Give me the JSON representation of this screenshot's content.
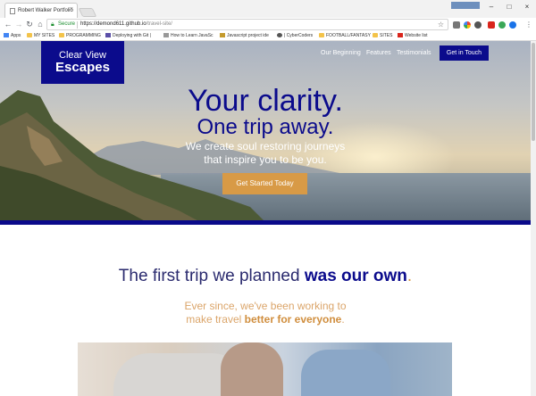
{
  "browser": {
    "tab_title": "Robert Walker Portfolio",
    "user_badge": "",
    "secure_label": "Secure",
    "url_host": "https://demond611.github.io",
    "url_path": "/travel-site/",
    "bookmarks": [
      {
        "label": "Apps",
        "icon": "apps-grid-icon"
      },
      {
        "label": "MY SITES",
        "icon": "folder-icon"
      },
      {
        "label": "PROGRAMMING",
        "icon": "folder-icon"
      },
      {
        "label": "Deploying with Git |",
        "icon": "page-icon"
      },
      {
        "label": "How to Learn JavaSc",
        "icon": "page-icon"
      },
      {
        "label": "Javascript project ide",
        "icon": "page-icon"
      },
      {
        "label": "| CyberCoders",
        "icon": "page-icon"
      },
      {
        "label": "FOOTBALL/FANTASY",
        "icon": "folder-icon"
      },
      {
        "label": "SITES",
        "icon": "folder-icon"
      },
      {
        "label": "Website list",
        "icon": "page-icon"
      }
    ]
  },
  "site": {
    "logo_line1": "Clear View",
    "logo_line2": "Escapes",
    "nav": [
      "Our Beginning",
      "Features",
      "Testimonials"
    ],
    "nav_cta": "Get in Touch",
    "headline_1": "Your clarity.",
    "headline_2": "One trip away.",
    "hero_sub_1": "We create soul restoring journeys",
    "hero_sub_2": "that inspire you to be you.",
    "hero_cta": "Get Started Today",
    "section_title_a": "The first trip we planned ",
    "section_title_b": "was our own",
    "section_title_c": ".",
    "section_sub_1": "Ever since, we've been working to",
    "section_sub_2a": "make travel ",
    "section_sub_2b": "better for everyone",
    "section_sub_2c": "."
  },
  "colors": {
    "brand_navy": "#0b0b8c",
    "accent_orange": "#d89a46"
  }
}
